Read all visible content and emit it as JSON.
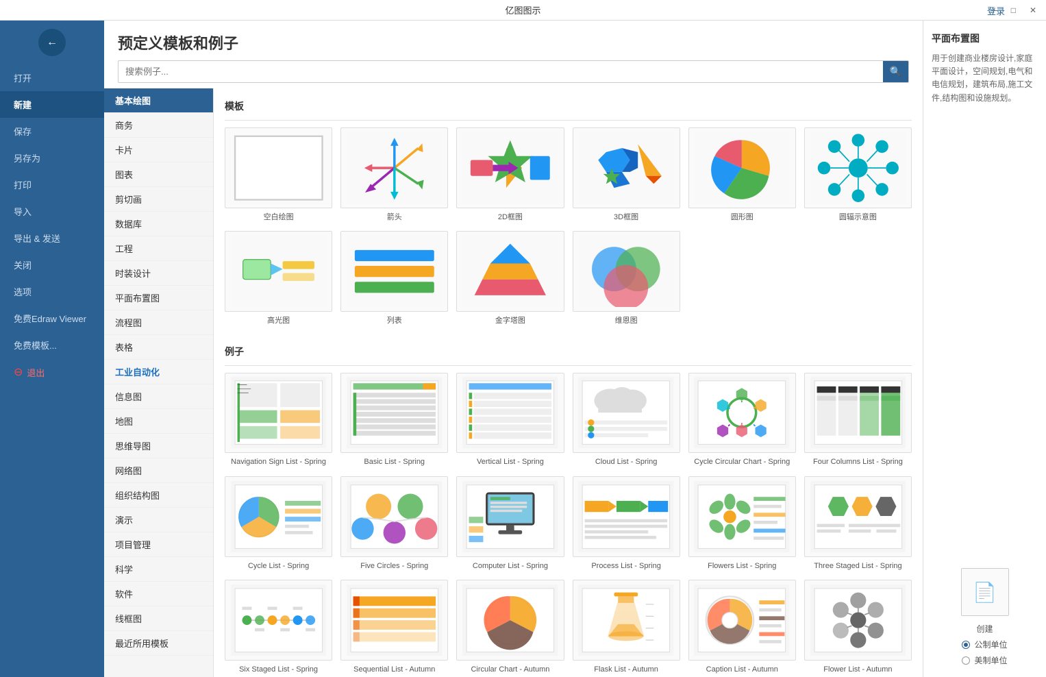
{
  "app": {
    "title": "亿图图示",
    "login_label": "登录"
  },
  "titlebar": {
    "minimize": "─",
    "maximize": "□",
    "close": "✕"
  },
  "sidebar": {
    "back_icon": "←",
    "items": [
      {
        "label": "打开",
        "id": "open",
        "active": false
      },
      {
        "label": "新建",
        "id": "new",
        "active": true
      },
      {
        "label": "保存",
        "id": "save",
        "active": false
      },
      {
        "label": "另存为",
        "id": "save-as",
        "active": false
      },
      {
        "label": "打印",
        "id": "print",
        "active": false
      },
      {
        "label": "导入",
        "id": "import",
        "active": false
      },
      {
        "label": "导出 & 发送",
        "id": "export",
        "active": false
      },
      {
        "label": "关闭",
        "id": "close",
        "active": false
      },
      {
        "label": "选项",
        "id": "options",
        "active": false
      },
      {
        "label": "免费Edraw Viewer",
        "id": "viewer",
        "active": false
      },
      {
        "label": "免费模板...",
        "id": "templates",
        "active": false
      },
      {
        "label": "退出",
        "id": "exit",
        "active": false,
        "danger": true
      }
    ]
  },
  "panel": {
    "title": "预定义模板和例子",
    "search_placeholder": "搜索例子..."
  },
  "nav_list": {
    "items": [
      {
        "label": "基本绘图",
        "active": true
      },
      {
        "label": "商务"
      },
      {
        "label": "卡片"
      },
      {
        "label": "图表"
      },
      {
        "label": "剪切画"
      },
      {
        "label": "数据库"
      },
      {
        "label": "工程"
      },
      {
        "label": "时装设计"
      },
      {
        "label": "平面布置图"
      },
      {
        "label": "流程图"
      },
      {
        "label": "表格"
      },
      {
        "label": "工业自动化",
        "bold": true
      },
      {
        "label": "信息图"
      },
      {
        "label": "地图"
      },
      {
        "label": "思维导图"
      },
      {
        "label": "网络图"
      },
      {
        "label": "组织结构图"
      },
      {
        "label": "演示"
      },
      {
        "label": "项目管理"
      },
      {
        "label": "科学"
      },
      {
        "label": "软件"
      },
      {
        "label": "线框图"
      },
      {
        "label": "最近所用模板"
      }
    ]
  },
  "sections": {
    "templates_label": "模板",
    "examples_label": "例子"
  },
  "templates": [
    {
      "id": "blank",
      "label": "空白绘图",
      "type": "blank"
    },
    {
      "id": "arrows",
      "label": "箭头",
      "type": "arrows"
    },
    {
      "id": "2d",
      "label": "2D框图",
      "type": "2d"
    },
    {
      "id": "3d",
      "label": "3D框图",
      "type": "3d"
    },
    {
      "id": "circle",
      "label": "圆形图",
      "type": "circle"
    },
    {
      "id": "radial",
      "label": "圆辐示意图",
      "type": "radial"
    },
    {
      "id": "highlight",
      "label": "高光图",
      "type": "highlight"
    },
    {
      "id": "list",
      "label": "列表",
      "type": "list"
    },
    {
      "id": "pyramid",
      "label": "金字塔图",
      "type": "pyramid"
    },
    {
      "id": "venn",
      "label": "维恩图",
      "type": "venn"
    }
  ],
  "examples": [
    {
      "id": "nav-sign",
      "label": "Navigation Sign List - Spring",
      "type": "spring-list-nav"
    },
    {
      "id": "basic-list",
      "label": "Basic List - Spring",
      "type": "spring-list-basic"
    },
    {
      "id": "vertical-list",
      "label": "Vertical List - Spring",
      "type": "spring-list-vertical"
    },
    {
      "id": "cloud-list",
      "label": "Cloud List - Spring",
      "type": "spring-list-cloud"
    },
    {
      "id": "cycle-chart",
      "label": "Cycle Circular Chart - Spring",
      "type": "spring-cycle-chart"
    },
    {
      "id": "four-columns",
      "label": "Four Columns List - Spring",
      "type": "spring-four-cols"
    },
    {
      "id": "cycle-list",
      "label": "Cycle List - Spring",
      "type": "spring-cycle-list"
    },
    {
      "id": "five-circles",
      "label": "Five Circles - Spring",
      "type": "spring-five-circles"
    },
    {
      "id": "computer-list",
      "label": "Computer List - Spring",
      "type": "spring-computer"
    },
    {
      "id": "process-list",
      "label": "Process List - Spring",
      "type": "spring-process"
    },
    {
      "id": "flowers-list",
      "label": "Flowers List - Spring",
      "type": "spring-flowers"
    },
    {
      "id": "three-staged",
      "label": "Three Staged List - Spring",
      "type": "spring-three-staged"
    },
    {
      "id": "six-staged",
      "label": "Six Staged List - Spring",
      "type": "spring-six-staged"
    },
    {
      "id": "sequential-list",
      "label": "Sequential List - Autumn",
      "type": "autumn-sequential"
    },
    {
      "id": "circular-chart",
      "label": "Circular Chart - Autumn",
      "type": "autumn-circular"
    },
    {
      "id": "flask-list",
      "label": "Flask List - Autumn",
      "type": "autumn-flask"
    },
    {
      "id": "caption-list",
      "label": "Caption List - Autumn",
      "type": "autumn-caption"
    },
    {
      "id": "flower-list-autumn",
      "label": "Flower List - Autumn",
      "type": "autumn-flower"
    }
  ],
  "right_panel": {
    "title": "平面布置图",
    "description": "用于创建商业楼房设计,家庭平面设计，空间规划,电气和电信规划，建筑布局,施工文件,结构图和设施规划。",
    "create_label": "创建",
    "units": [
      {
        "label": "公制单位",
        "checked": true
      },
      {
        "label": "美制单位",
        "checked": false
      }
    ]
  }
}
